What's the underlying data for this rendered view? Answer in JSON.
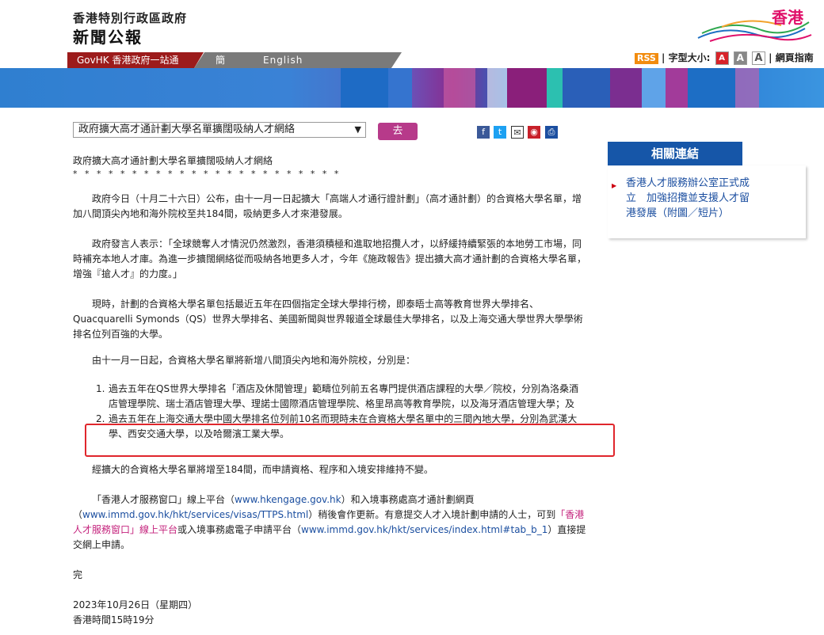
{
  "header": {
    "gov_name": "香港特別行政區政府",
    "sub_title": "新聞公報",
    "logo_text": "香港"
  },
  "nav": {
    "govhk": "GovHK 香港政府一站通",
    "simplified": "簡体版",
    "english": "English"
  },
  "tools": {
    "rss": "RSS",
    "font_size_label": "字型大小:",
    "font_a": "A",
    "sitemap": "網頁指南"
  },
  "selector": {
    "selected": "政府擴大高才通計劃大學名單擴闊吸納人才網絡",
    "go_label": "去"
  },
  "article": {
    "title": "政府擴大高才通計劃大學名單擴闊吸納人才網絡",
    "stars": "* * * * * * * * * * * * * * * * * * * * * * *",
    "p1": "政府今日（十月二十六日）公布，由十一月一日起擴大「高端人才通行證計劃」（高才通計劃）的合資格大學名單，增加八間頂尖內地和海外院校至共184間，吸納更多人才來港發展。",
    "p2": "政府發言人表示：「全球競奪人才情況仍然激烈，香港須積極和進取地招攬人才，以紓緩持續緊張的本地勞工市場，同時補充本地人才庫。為進一步擴闊網絡從而吸納各地更多人才，今年《施政報告》提出擴大高才通計劃的合資格大學名單，增強『搶人才』的力度。」",
    "p3": "現時，計劃的合資格大學名單包括最近五年在四個指定全球大學排行榜，即泰晤士高等教育世界大學排名、Quacquarelli Symonds（QS）世界大學排名、美國新聞與世界報道全球最佳大學排名，以及上海交通大學世界大學學術排名位列百強的大學。",
    "p4": "由十一月一日起，合資格大學名單將新增八間頂尖內地和海外院校，分別是：",
    "item1_num": "1.",
    "item1": "過去五年在QS世界大學排名「酒店及休閒管理」範疇位列前五名專門提供酒店課程的大學／院校，分別為洛桑酒店管理學院、瑞士酒店管理大學、理諾士國際酒店管理學院、格里昂高等教育學院，以及海牙酒店管理大學；及",
    "item2_num": "2.",
    "item2": "過去五年在上海交通大學中國大學排名位列前10名而現時未在合資格大學名單中的三間內地大學，分別為武漢大學、西安交通大學，以及哈爾濱工業大學。",
    "p5": "經擴大的合資格大學名單將增至184間，而申請資格、程序和入境安排維持不變。",
    "p6_a": "「香港人才服務窗口」線上平台（",
    "p6_link1": "www.hkengage.gov.hk",
    "p6_b": "）和入境事務處高才通計劃網頁（",
    "p6_link2": "www.immd.gov.hk/hkt/services/visas/TTPS.html",
    "p6_c": "）稍後會作更新。有意提交人才入境計劃申請的人士，可到",
    "p6_link3": "「香港人才服務窗口」線上平台",
    "p6_d": "或入境事務處電子申請平台（",
    "p6_link4": "www.immd.gov.hk/hkt/services/index.html#tab_b_1",
    "p6_e": "）直接提交網上申請。",
    "end": "完",
    "date": "2023年10月26日（星期四）",
    "time": "香港時間15時19分"
  },
  "related": {
    "title": "相關連結",
    "link": "香港人才服務辦公室正式成立　加強招攬並支援人才留港發展（附圖／短片）"
  },
  "colors": {
    "govhk_bar": "#9c1b1b",
    "related_title": "#1656a8",
    "go_button": "#b73a8a",
    "highlight_box": "#e0262c"
  }
}
